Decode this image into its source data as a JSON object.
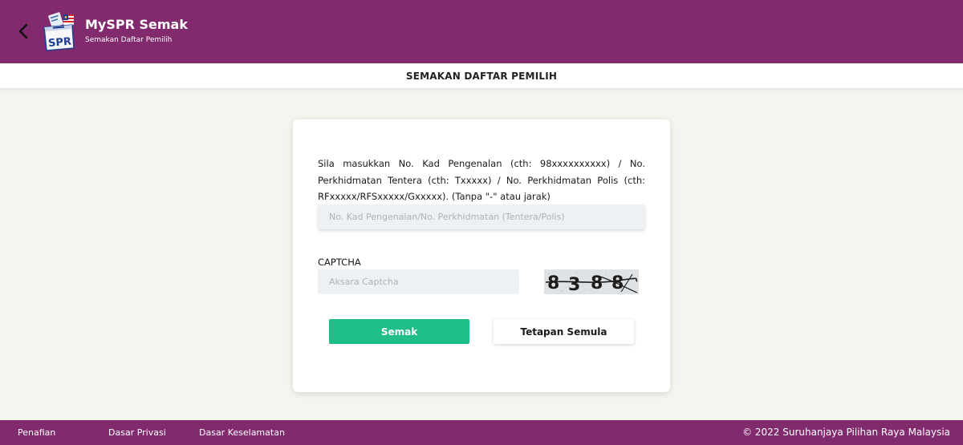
{
  "header": {
    "title": "MySPR Semak",
    "subtitle": "Semakan Daftar Pemilih",
    "logo_text": "SPR",
    "back_icon": "chevron-left-icon",
    "background_color": "#822a6e"
  },
  "page": {
    "heading": "SEMAKAN DAFTAR PEMILIH"
  },
  "form": {
    "instruction": "Sila masukkan No. Kad Pengenalan (cth: 98xxxxxxxxxx) / No. Perkhidmatan Tentera (cth: Txxxxx) / No. Perkhidmatan Polis (cth: RFxxxxx/RFSxxxxx/Gxxxxx). (Tanpa \"-\" atau jarak)",
    "ic_placeholder": "No. Kad Pengenalan/No. Perkhidmatan (Tentera/Polis)",
    "ic_value": "",
    "captcha_label": "CAPTCHA",
    "captcha_placeholder": "Aksara Captcha",
    "captcha_value": "",
    "captcha_chars": [
      "8",
      "3",
      "8",
      "8"
    ],
    "submit_label": "Semak",
    "reset_label": "Tetapan Semula",
    "submit_color": "#1fbd8a"
  },
  "footer": {
    "links": [
      "Penafian",
      "Dasar Privasi",
      "Dasar Keselamatan"
    ],
    "copyright": "© 2022 Suruhanjaya Pilihan Raya Malaysia"
  }
}
